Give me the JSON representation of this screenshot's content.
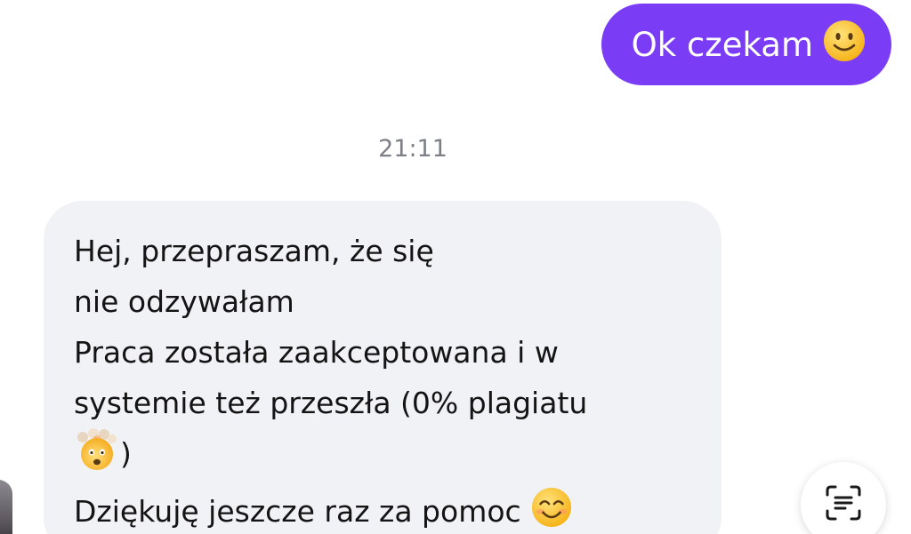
{
  "outgoing_message": {
    "text": "Ok czekam",
    "emoji": "slightly-smiling-face"
  },
  "timestamp": "21:11",
  "incoming_message": {
    "lines": [
      "Hej, przepraszam, że się",
      "nie odzywałam",
      "Praca została zaakceptowana i w",
      "systemie też przeszła (0% plagiatu",
      ")",
      "Dziękuję jeszcze raz za pomoc"
    ],
    "emojis": [
      "shocked-face-with-exploding-head",
      "smiling-face-with-smiling-eyes"
    ]
  },
  "colors": {
    "outgoing_bubble": "#7b3cf6",
    "incoming_bubble": "#f1f2f6",
    "timestamp": "#7c7f86"
  },
  "icons": {
    "scan_button": "text-scan-icon"
  }
}
